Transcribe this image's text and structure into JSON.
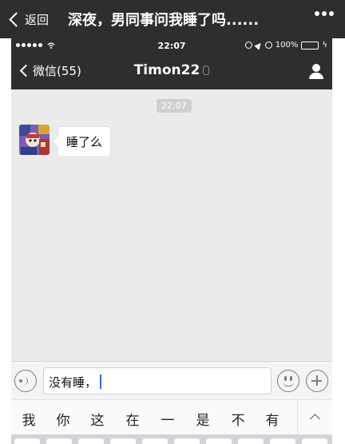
{
  "outer_header": {
    "back_label": "返回",
    "title": "深夜，男同事问我睡了吗......"
  },
  "status_bar": {
    "time": "22:07",
    "battery_percent": "100%",
    "battery_level": 1.0
  },
  "nav": {
    "back_label": "微信(55)",
    "title": "Timon22"
  },
  "chat": {
    "timestamp": "22:07",
    "messages": [
      {
        "sender": "Timon22",
        "side": "left",
        "text": "睡了么"
      }
    ]
  },
  "input": {
    "value": "没有睡，"
  },
  "candidates": [
    "我",
    "你",
    "这",
    "在",
    "一",
    "是",
    "不",
    "有"
  ],
  "colors": {
    "header_bg": "#2e2e2e",
    "chat_bg": "#ebebeb",
    "battery": "#f5c518",
    "caret": "#2a6cd8"
  },
  "icons": [
    "chevron-left-icon",
    "more-icon",
    "signal-icon",
    "wifi-icon",
    "lock-rotation-icon",
    "location-icon",
    "alarm-icon",
    "battery-icon",
    "charging-icon",
    "ear-icon",
    "profile-icon",
    "voice-icon",
    "emoji-icon",
    "plus-icon",
    "chevron-up-icon"
  ]
}
